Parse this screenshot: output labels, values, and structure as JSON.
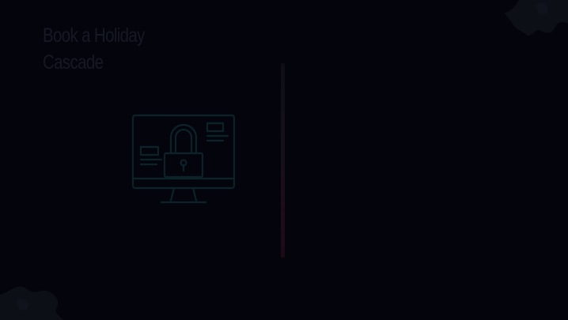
{
  "slide": {
    "title_line1": "Book a Holiday",
    "title_line2": "Cascade"
  },
  "icons": {
    "main": "computer-lock-icon",
    "corners": "puzzle-piece-icon"
  },
  "colors": {
    "background": "#03040c",
    "title_text": "#161924",
    "icon_stroke": "#0b2229",
    "divider": "#1c0b14",
    "corner_shape": "#0d0f17"
  }
}
